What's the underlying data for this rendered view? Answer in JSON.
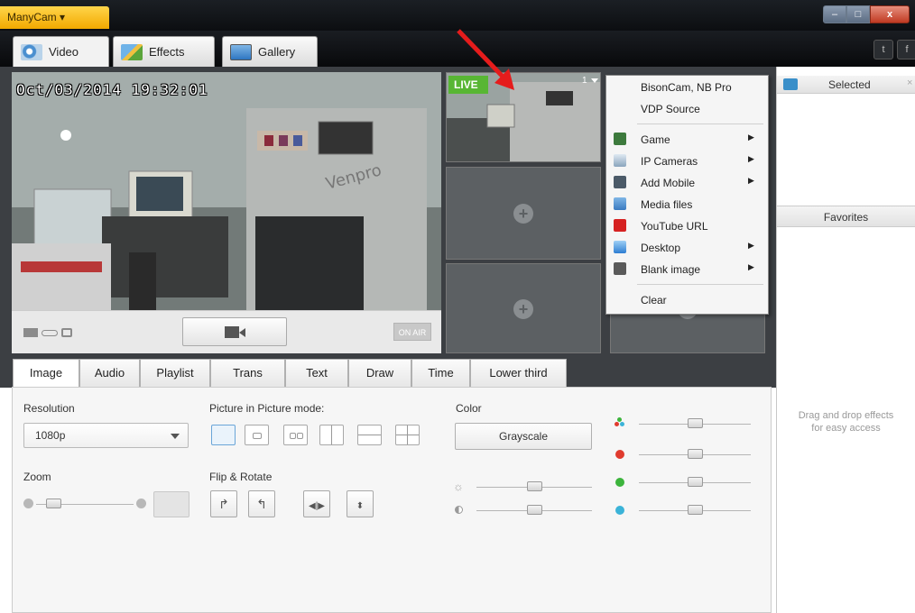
{
  "app": {
    "menu_label": "ManyCam ▾"
  },
  "window_controls": {
    "minimize": "–",
    "maximize": "□",
    "close": "x"
  },
  "top_tabs": [
    {
      "label": "Video"
    },
    {
      "label": "Effects"
    },
    {
      "label": "Gallery"
    }
  ],
  "social": {
    "tumblr": "t",
    "facebook": "f"
  },
  "preview": {
    "timestamp": "Oct/03/2014 19:32:01",
    "on_air": "ON AIR"
  },
  "live_badge": "LIVE",
  "slot_index": "1",
  "context_menu": {
    "items": [
      {
        "label": "BisonCam, NB Pro"
      },
      {
        "label": "VDP Source"
      },
      {
        "label": "Game"
      },
      {
        "label": "IP Cameras"
      },
      {
        "label": "Add Mobile"
      },
      {
        "label": "Media files"
      },
      {
        "label": "YouTube URL"
      },
      {
        "label": "Desktop"
      },
      {
        "label": "Blank image"
      },
      {
        "label": "Clear"
      }
    ]
  },
  "right_panel": {
    "selected": "Selected",
    "favorites": "Favorites",
    "drag_hint_1": "Drag and drop effects",
    "drag_hint_2": "for easy access"
  },
  "sub_tabs": [
    {
      "label": "Image"
    },
    {
      "label": "Audio"
    },
    {
      "label": "Playlist"
    },
    {
      "label": "Trans"
    },
    {
      "label": "Text"
    },
    {
      "label": "Draw"
    },
    {
      "label": "Time"
    },
    {
      "label": "Lower third"
    }
  ],
  "settings": {
    "resolution_label": "Resolution",
    "resolution_value": "1080p",
    "pip_label": "Picture in Picture mode:",
    "color_label": "Color",
    "grayscale_label": "Grayscale",
    "zoom_label": "Zoom",
    "flip_label": "Flip & Rotate"
  },
  "colors": {
    "accent": "#f2a900",
    "live": "#58b634",
    "red": "#e03b2e",
    "green": "#3cb43c",
    "blue": "#3bb3d8"
  }
}
